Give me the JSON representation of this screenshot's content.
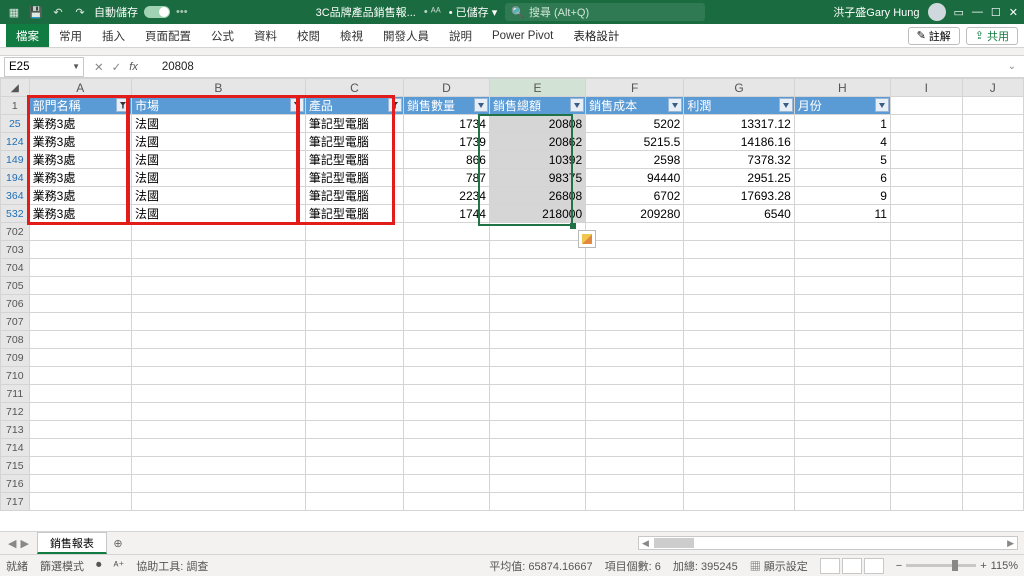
{
  "titlebar": {
    "autosave_label": "自動儲存",
    "doc_name": "3C品牌產品銷售報...",
    "saved_indicator": "• 已儲存  ▾",
    "search_placeholder": "搜尋 (Alt+Q)",
    "user_name": "洪子盛Gary Hung"
  },
  "ribbon": {
    "tabs": [
      "檔案",
      "常用",
      "插入",
      "頁面配置",
      "公式",
      "資料",
      "校閱",
      "檢視",
      "開發人員",
      "說明",
      "Power Pivot",
      "表格設計"
    ],
    "comments_btn": "註解",
    "share_btn": "共用"
  },
  "namebox": {
    "ref": "E25"
  },
  "formula_bar": {
    "value": "20808"
  },
  "columns": [
    "A",
    "B",
    "C",
    "D",
    "E",
    "F",
    "G",
    "H",
    "I",
    "J"
  ],
  "headers": {
    "dept": "部門名稱",
    "market": "市場",
    "product": "產品",
    "qty": "銷售數量",
    "total": "銷售總額",
    "cost": "銷售成本",
    "profit": "利潤",
    "month": "月份"
  },
  "rows": [
    {
      "n": 25,
      "dept": "業務3處",
      "market": "法國",
      "product": "筆記型電腦",
      "qty": 1734,
      "total": 20808,
      "cost": 5202,
      "profit": "13317.12",
      "month": 1
    },
    {
      "n": 124,
      "dept": "業務3處",
      "market": "法國",
      "product": "筆記型電腦",
      "qty": 1739,
      "total": 20862,
      "cost": "5215.5",
      "profit": "14186.16",
      "month": 4
    },
    {
      "n": 149,
      "dept": "業務3處",
      "market": "法國",
      "product": "筆記型電腦",
      "qty": 866,
      "total": 10392,
      "cost": 2598,
      "profit": "7378.32",
      "month": 5
    },
    {
      "n": 194,
      "dept": "業務3處",
      "market": "法國",
      "product": "筆記型電腦",
      "qty": 787,
      "total": 98375,
      "cost": 94440,
      "profit": "2951.25",
      "month": 6
    },
    {
      "n": 364,
      "dept": "業務3處",
      "market": "法國",
      "product": "筆記型電腦",
      "qty": 2234,
      "total": 26808,
      "cost": 6702,
      "profit": "17693.28",
      "month": 9
    },
    {
      "n": 532,
      "dept": "業務3處",
      "market": "法國",
      "product": "筆記型電腦",
      "qty": 1744,
      "total": 218000,
      "cost": 209280,
      "profit": "6540",
      "month": 11
    }
  ],
  "empty_rows": [
    702,
    703,
    704,
    705,
    706,
    707,
    708,
    709,
    710,
    711,
    712,
    713,
    714,
    715,
    716,
    717
  ],
  "sheetbar": {
    "active_tab": "銷售報表"
  },
  "statusbar": {
    "ready": "就緒",
    "filter_mode": "篩選模式",
    "acc_label": "協助工具: 調查",
    "avg_label": "平均值:",
    "avg": "65874.16667",
    "count_label": "項目個數:",
    "count": "6",
    "sum_label": "加總:",
    "sum": "395245",
    "display_settings": "顯示設定",
    "zoom": "115%"
  }
}
